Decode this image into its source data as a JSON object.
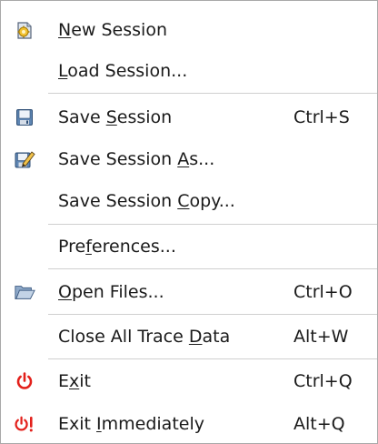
{
  "menu": {
    "items": [
      {
        "pre": "",
        "mnemonic": "N",
        "post": "ew Session",
        "shortcut": "",
        "icon": "new-session-icon"
      },
      {
        "pre": "",
        "mnemonic": "L",
        "post": "oad Session...",
        "shortcut": "",
        "icon": ""
      },
      {
        "pre": "Save ",
        "mnemonic": "S",
        "post": "ession",
        "shortcut": "Ctrl+S",
        "icon": "save-icon"
      },
      {
        "pre": "Save Session ",
        "mnemonic": "A",
        "post": "s...",
        "shortcut": "",
        "icon": "save-as-icon"
      },
      {
        "pre": "Save Session ",
        "mnemonic": "C",
        "post": "opy...",
        "shortcut": "",
        "icon": ""
      },
      {
        "pre": "Pre",
        "mnemonic": "f",
        "post": "erences...",
        "shortcut": "",
        "icon": ""
      },
      {
        "pre": "",
        "mnemonic": "O",
        "post": "pen Files...",
        "shortcut": "Ctrl+O",
        "icon": "folder-open-icon"
      },
      {
        "pre": "Close All Trace ",
        "mnemonic": "D",
        "post": "ata",
        "shortcut": "Alt+W",
        "icon": ""
      },
      {
        "pre": "E",
        "mnemonic": "x",
        "post": "it",
        "shortcut": "Ctrl+Q",
        "icon": "power-icon"
      },
      {
        "pre": "Exit ",
        "mnemonic": "I",
        "post": "mmediately",
        "shortcut": "Alt+Q",
        "icon": "power-urgent-icon"
      }
    ]
  },
  "colors": {
    "power_red": "#e3201b",
    "separator": "#cfcfcf"
  }
}
